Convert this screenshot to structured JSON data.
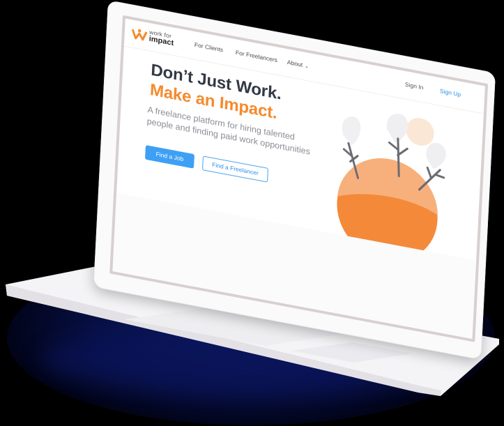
{
  "brand": {
    "logo_line1": "work for",
    "logo_line2": "impact",
    "accent": "#f58a2c",
    "blue": "#3ea0f4"
  },
  "nav": {
    "items": [
      {
        "label": "For Clients"
      },
      {
        "label": "For Freelancers"
      },
      {
        "label": "About"
      }
    ],
    "signin": "Sign In",
    "signup": "Sign Up"
  },
  "hero": {
    "title_line1": "Don’t Just Work.",
    "title_line2": "Make an Impact.",
    "lead": "A freelance platform for hiring talented people and finding paid work opportunities",
    "btn_primary": "Find a Job",
    "btn_secondary": "Find a Freelancer"
  },
  "icons": {
    "about_chevron": "chevron-down-icon",
    "logo": "logo-icon",
    "illustration": "planet-with-trees-illustration"
  }
}
